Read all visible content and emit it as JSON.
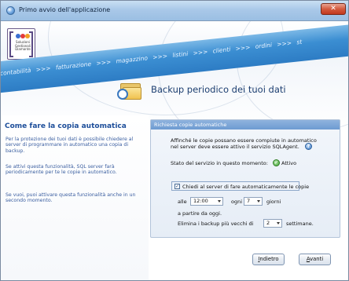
{
  "window": {
    "title": "Primo avvio dell'applicazione",
    "close_glyph": "✕"
  },
  "logo": {
    "line1": "Soluzioni",
    "line2": "Gestionali",
    "line3": "Diamante"
  },
  "ribbon": {
    "items": [
      "contabilità",
      ">>>",
      "fatturazione",
      ">>>",
      "magazzino",
      ">>>",
      "listini",
      ">>>",
      "clienti",
      ">>>",
      "ordini",
      ">>>",
      "st"
    ]
  },
  "header": {
    "title": "Backup periodico dei tuoi dati"
  },
  "left": {
    "title": "Come fare la copia automatica",
    "p1": "Per la protezione dei tuoi dati è possibile chiedere al server di programmare in automatico una copia di backup.",
    "p2": "Se attivi questa funzionalità, SQL server farà periodicamente per te le copie in automatico.",
    "p3": "Se vuoi, puoi attivare questa funzionalità anche in un secondo momento."
  },
  "group": {
    "header": "Richiesta copie automatiche",
    "info_line1": "Affinché le copie possano essere compiute in automatico",
    "info_line2": "nel server deve essere attivo il servizio SQLAgent.",
    "status_label": "Stato del servizio in questo momento:",
    "status_value": "Attivo",
    "checkbox_label": "Chiedi al server di fare automaticamente le copie",
    "checkbox_checked": true,
    "at_label": "alle",
    "time_value": "12:00",
    "every_label": "ogni",
    "days_value": "7",
    "days_label": "giorni",
    "from_label": "a partire da oggi.",
    "delete_label": "Elimina i backup più vecchi di",
    "weeks_value": "2",
    "weeks_label": "settimane."
  },
  "buttons": {
    "back_prefix": "I",
    "back_rest": "ndietro",
    "next_prefix": "A",
    "next_rest": "vanti"
  },
  "colors": {
    "accent": "#1d4e9a",
    "ribbon": "#3b8ed2",
    "group_header": "#6d9bd2"
  },
  "icons": {
    "help": "?",
    "ok": "✓",
    "check": "✓"
  }
}
